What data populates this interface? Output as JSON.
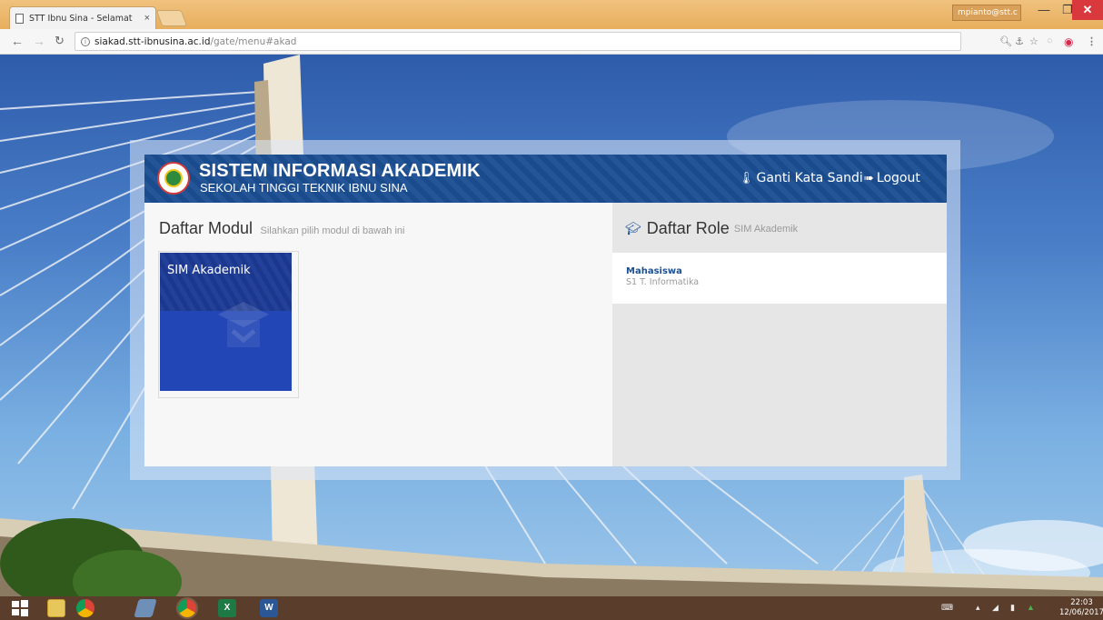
{
  "browser": {
    "tab_title": "STT Ibnu Sina - Selamat",
    "tab_close": "×",
    "profile_label": "mpianto@stt.c",
    "url_host": "siakad.stt-ibnusina.ac.id",
    "url_path": "/gate/menu#akad"
  },
  "header": {
    "title": "SISTEM INFORMASI AKADEMIK",
    "subtitle": "SEKOLAH TINGGI TEKNIK IBNU SINA",
    "change_password": "Ganti Kata Sandi",
    "logout": "Logout"
  },
  "modules": {
    "title": "Daftar Modul",
    "subtitle": "Silahkan pilih modul di bawah ini",
    "items": [
      {
        "label": "SIM Akademik"
      }
    ]
  },
  "roles": {
    "title": "Daftar Role",
    "subtitle": "SIM Akademik",
    "items": [
      {
        "name": "Mahasiswa",
        "description": "S1 T. Informatika"
      }
    ]
  },
  "taskbar": {
    "time": "22:03",
    "date": "12/06/2017"
  },
  "colors": {
    "header_blue": "#1b4f93",
    "module_tile": "#2246b5",
    "window_close": "#d9383c",
    "titlebar": "#e8ae5d"
  }
}
